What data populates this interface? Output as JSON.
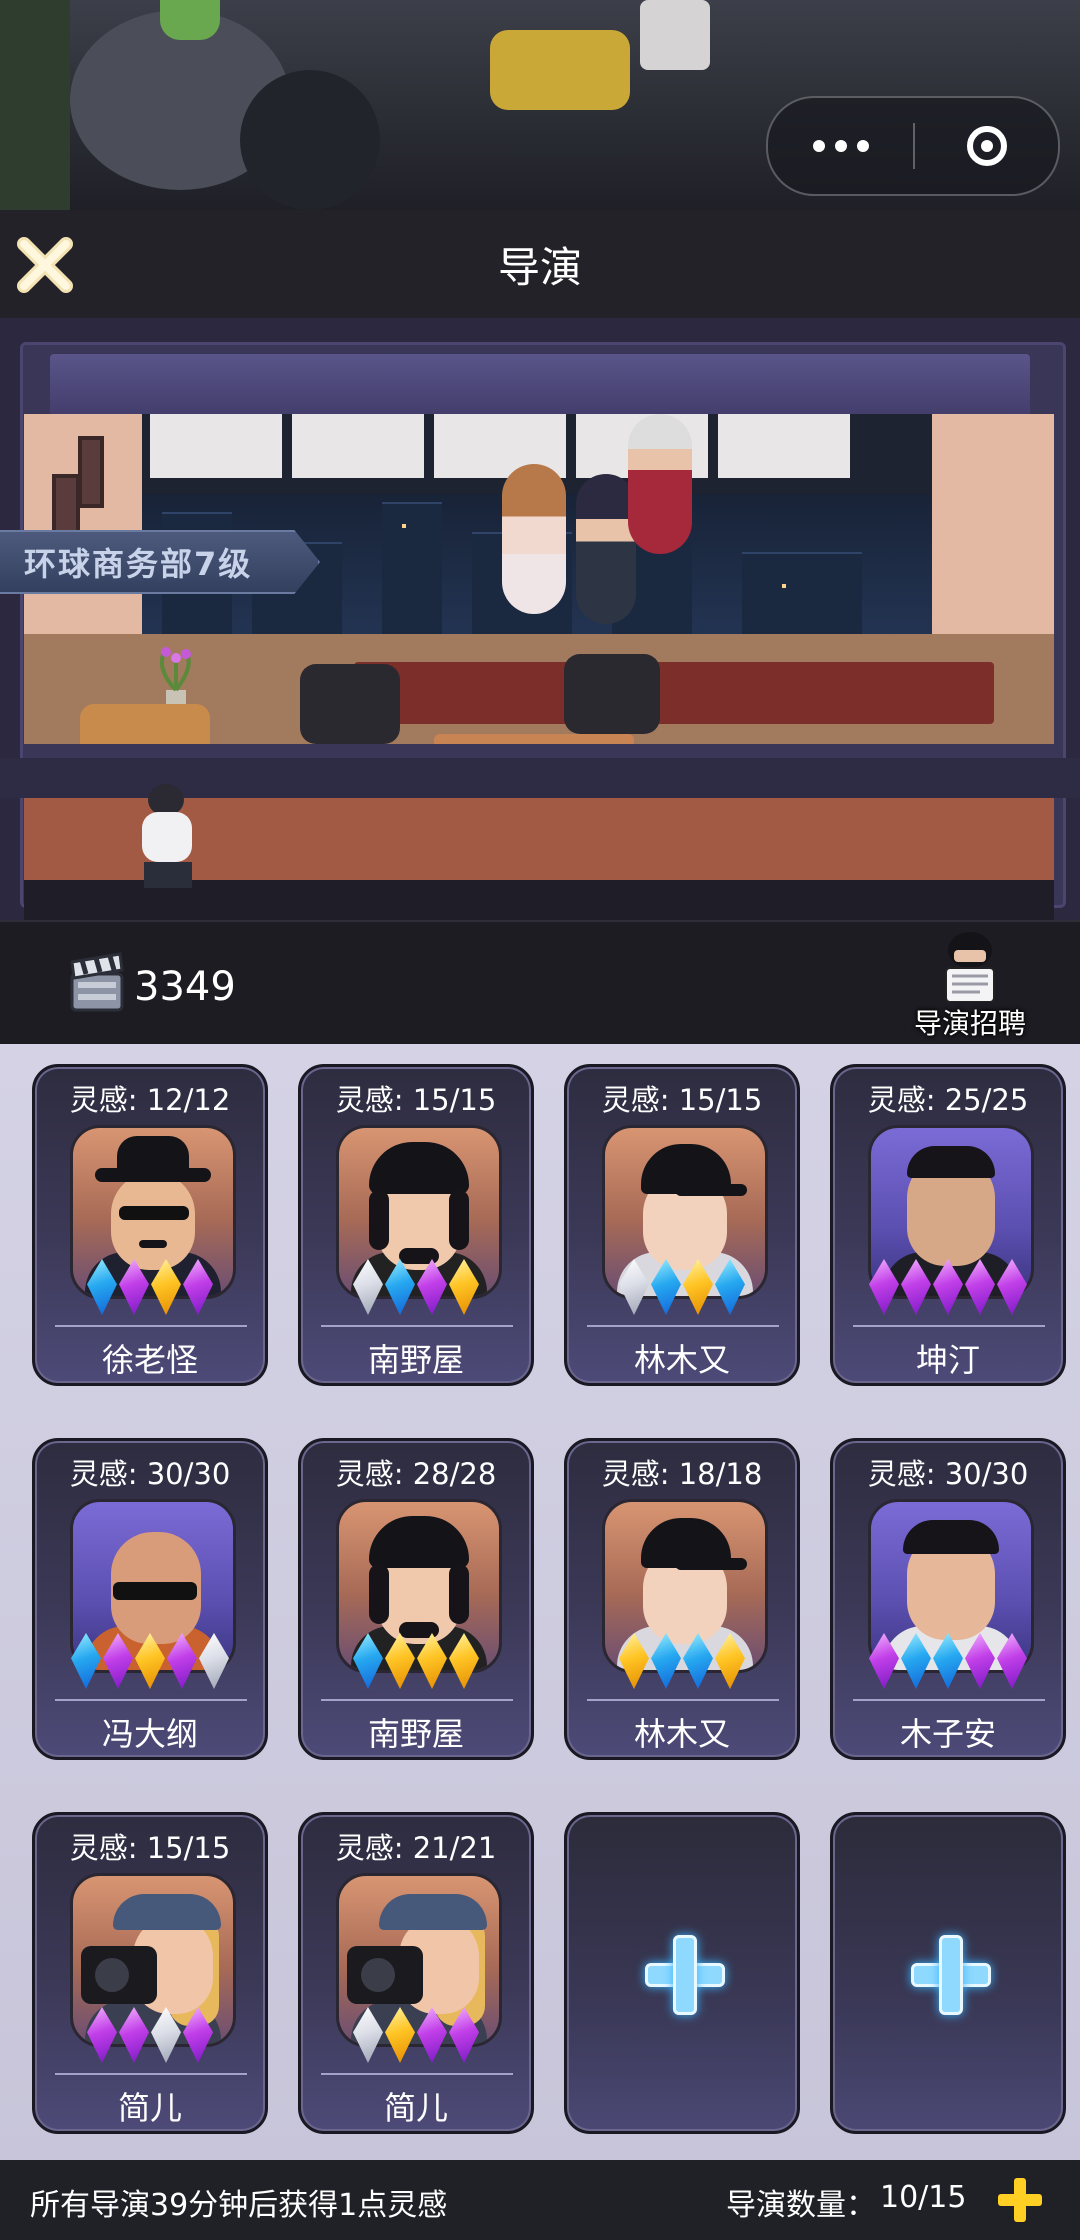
{
  "header": {
    "title": "导演"
  },
  "office": {
    "department": "环球商务部7级"
  },
  "resources": {
    "film_count": "3349"
  },
  "recruit": {
    "label": "导演招聘"
  },
  "directors": [
    {
      "inspiration": "灵感: 12/12",
      "name": "徐老怪",
      "gems": [
        "blue",
        "purple",
        "gold",
        "purple"
      ],
      "portrait": "hat-sunglasses"
    },
    {
      "inspiration": "灵感: 15/15",
      "name": "南野屋",
      "gems": [
        "white",
        "blue",
        "purple",
        "gold"
      ],
      "portrait": "beanie-curly"
    },
    {
      "inspiration": "灵感: 15/15",
      "name": "林木又",
      "gems": [
        "white",
        "blue",
        "gold",
        "blue"
      ],
      "portrait": "cap-suit"
    },
    {
      "inspiration": "灵感: 25/25",
      "name": "坤汀",
      "gems": [
        "purple",
        "purple",
        "purple",
        "purple",
        "purple"
      ],
      "portrait": "real-man"
    },
    {
      "inspiration": "灵感: 30/30",
      "name": "冯大纲",
      "gems": [
        "blue",
        "purple",
        "gold",
        "purple",
        "white"
      ],
      "portrait": "bald-sunglasses"
    },
    {
      "inspiration": "灵感: 28/28",
      "name": "南野屋",
      "gems": [
        "blue",
        "gold",
        "gold",
        "gold"
      ],
      "portrait": "beanie-curly"
    },
    {
      "inspiration": "灵感: 18/18",
      "name": "林木又",
      "gems": [
        "gold",
        "blue",
        "blue",
        "gold"
      ],
      "portrait": "cap-suit"
    },
    {
      "inspiration": "灵感: 30/30",
      "name": "木子安",
      "gems": [
        "purple",
        "blue",
        "blue",
        "purple",
        "purple"
      ],
      "portrait": "real-man-2"
    },
    {
      "inspiration": "灵感: 15/15",
      "name": "简儿",
      "gems": [
        "purple",
        "purple",
        "white",
        "purple"
      ],
      "portrait": "camera-woman"
    },
    {
      "inspiration": "灵感: 21/21",
      "name": "简儿",
      "gems": [
        "white",
        "gold",
        "purple",
        "purple"
      ],
      "portrait": "camera-woman"
    }
  ],
  "empty_slots": 2,
  "footer": {
    "tip": "所有导演39分钟后获得1点灵感",
    "count_label": "导演数量：",
    "count_value": "10/15"
  },
  "colors": {
    "gem_blue": "#26a8f0",
    "gem_purple": "#c13fe8",
    "gem_gold": "#ffc424",
    "gem_white": "#dcdfe8",
    "plus_accent": "#ffcf23"
  }
}
